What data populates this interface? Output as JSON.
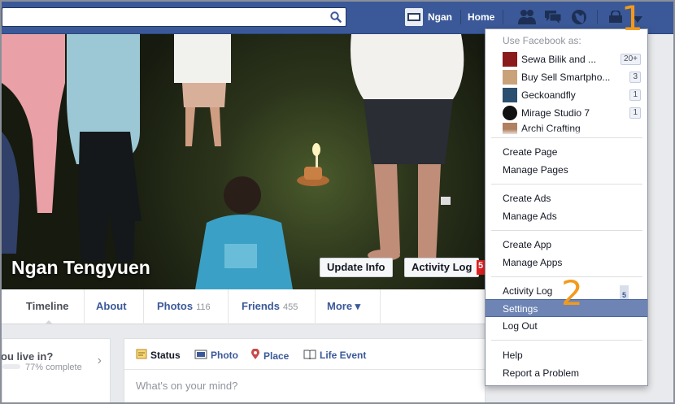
{
  "topbar": {
    "user_name": "Ngan",
    "home_label": "Home"
  },
  "profile": {
    "name": "Ngan Tengyuen",
    "update_info_label": "Update Info",
    "activity_log_label": "Activity Log",
    "activity_log_badge": "5"
  },
  "tabs": [
    {
      "label": "Timeline",
      "count": ""
    },
    {
      "label": "About",
      "count": ""
    },
    {
      "label": "Photos",
      "count": "116"
    },
    {
      "label": "Friends",
      "count": "455"
    },
    {
      "label": "More ▾",
      "count": ""
    }
  ],
  "left_card": {
    "question": "ou live in?",
    "progress_text": "77% complete",
    "progress_fraction": 0.77
  },
  "composer": {
    "tabs": [
      "Status",
      "Photo",
      "Place",
      "Life Event"
    ],
    "placeholder": "What's on your mind?"
  },
  "menu": {
    "header": "Use Facebook as:",
    "pages": [
      {
        "name": "Sewa Bilik and ...",
        "badge": "20+",
        "color": "#8b1a1a"
      },
      {
        "name": "Buy Sell Smartpho...",
        "badge": "3",
        "color": "#c9a27a"
      },
      {
        "name": "Geckoandfly",
        "badge": "1",
        "color": "#2b4f6e"
      },
      {
        "name": "Mirage Studio 7",
        "badge": "1",
        "color": "#111111"
      },
      {
        "name": "Archi Crafting",
        "badge": "",
        "color": "#b08060"
      }
    ],
    "groups": [
      [
        "Create Page",
        "Manage Pages"
      ],
      [
        "Create Ads",
        "Manage Ads"
      ],
      [
        "Create App",
        "Manage Apps"
      ],
      [
        "Activity Log",
        "Settings",
        "Log Out"
      ],
      [
        "Help",
        "Report a Problem"
      ]
    ],
    "activity_log_badge": "5",
    "selected_item": "Settings"
  },
  "annotations": [
    "1",
    "2"
  ],
  "colors": {
    "brand_blue": "#3b5998",
    "menu_highlight": "#6d84b4",
    "annotation_orange": "#f39a1c"
  },
  "icons": [
    "search-icon",
    "friend-requests-icon",
    "messages-icon",
    "notifications-globe-icon",
    "privacy-lock-icon",
    "account-menu-arrow-icon"
  ]
}
